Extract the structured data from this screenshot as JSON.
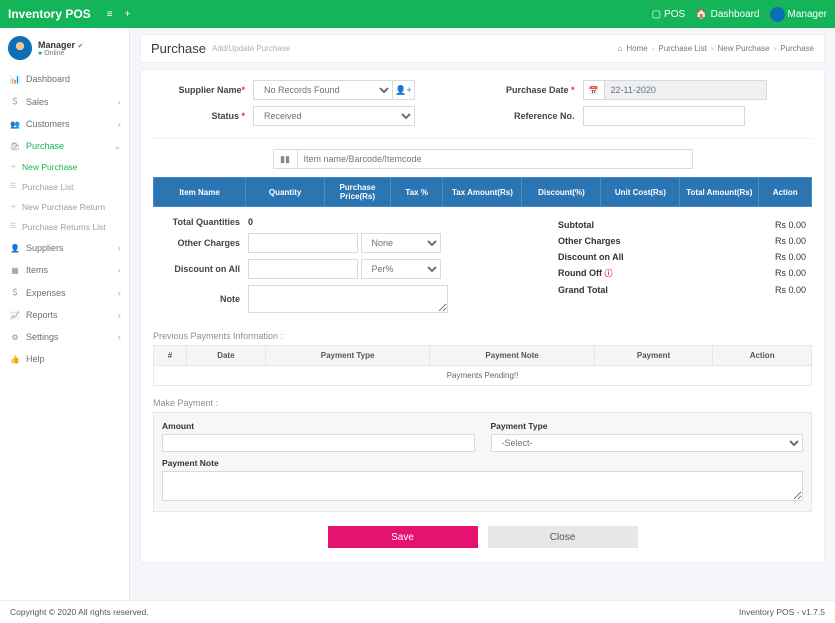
{
  "app": {
    "name": "Inventory POS"
  },
  "topbar": {
    "pos": "POS",
    "dashboard": "Dashboard",
    "user": "Manager"
  },
  "user_panel": {
    "name": "Manager",
    "status": "Online"
  },
  "nav": {
    "dashboard": "Dashboard",
    "sales": "Sales",
    "customers": "Customers",
    "purchase": "Purchase",
    "suppliers": "Suppliers",
    "items": "Items",
    "expenses": "Expenses",
    "reports": "Reports",
    "settings": "Settings",
    "help": "Help",
    "sub": {
      "new_purchase": "New Purchase",
      "purchase_list": "Purchase List",
      "new_purchase_return": "New Purchase Return",
      "purchase_returns_list": "Purchase Returns List"
    }
  },
  "page": {
    "title": "Purchase",
    "subtitle": "Add/Update Purchase",
    "crumbs": {
      "home": "Home",
      "plist": "Purchase List",
      "np": "New Purchase",
      "cur": "Purchase"
    }
  },
  "form": {
    "supplier_label": "Supplier Name",
    "supplier_value": "No Records Found",
    "status_label": "Status",
    "status_value": "Received",
    "date_label": "Purchase Date",
    "date_value": "22-11-2020",
    "ref_label": "Reference No.",
    "ref_value": "",
    "search_placeholder": "Item name/Barcode/Itemcode"
  },
  "items_table": {
    "h_item": "Item Name",
    "h_qty": "Quantity",
    "h_price": "Purchase Price(Rs)",
    "h_tax": "Tax %",
    "h_taxamt": "Tax Amount(Rs)",
    "h_disc": "Discount(%)",
    "h_unit": "Unit Cost(Rs)",
    "h_total": "Total Amount(Rs)",
    "h_action": "Action"
  },
  "mid": {
    "tq_label": "Total Quantities",
    "tq_value": "0",
    "oc_label": "Other Charges",
    "oc_sel": "None",
    "da_label": "Discount on All",
    "da_sel": "Per%",
    "note_label": "Note"
  },
  "totals": {
    "subtotal_l": "Subtotal",
    "subtotal_v": "Rs 0.00",
    "other_l": "Other Charges",
    "other_v": "Rs 0.00",
    "disc_l": "Discount on All",
    "disc_v": "Rs 0.00",
    "round_l": "Round Off",
    "round_v": "Rs 0.00",
    "grand_l": "Grand Total",
    "grand_v": "Rs 0.00"
  },
  "prev_pay": {
    "title": "Previous Payments Information :",
    "h_num": "#",
    "h_date": "Date",
    "h_type": "Payment Type",
    "h_note": "Payment Note",
    "h_pay": "Payment",
    "h_action": "Action",
    "empty": "Payments Pending!!"
  },
  "make_pay": {
    "title": "Make Payment :",
    "amount_l": "Amount",
    "type_l": "Payment Type",
    "type_v": "-Select-",
    "note_l": "Payment Note"
  },
  "buttons": {
    "save": "Save",
    "close": "Close"
  },
  "footer": {
    "left": "Copyright © 2020 All rights reserved.",
    "right": "Inventory POS - v1.7.5"
  }
}
